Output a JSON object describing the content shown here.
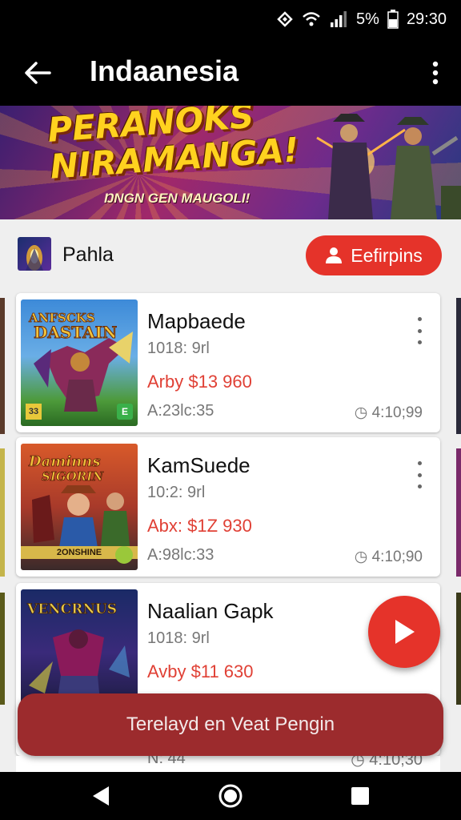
{
  "status_bar": {
    "battery_text": "5%",
    "time": "29:30",
    "icons": [
      "nfc-icon",
      "wifi-icon",
      "signal-icon",
      "battery-icon"
    ]
  },
  "app_bar": {
    "title": "Indaanesia",
    "icons": [
      "back-arrow-icon",
      "more-vert-icon"
    ]
  },
  "banner": {
    "title_line1": "PERANOKS",
    "title_line2": "NIRAMANGA!",
    "subtitle": "ŊNGN GEN MAUGOLI!"
  },
  "section": {
    "name": "Pahla",
    "follow_label": "Eefirpins"
  },
  "cards": [
    {
      "title": "Mapbaede",
      "subtitle": "1018: 9rl",
      "price": "Arby $13 960",
      "meta": "A:23lc:35",
      "time": "4:10;99",
      "thumb_text": "ANFSCKS DASTAIN",
      "thumb_colors": [
        "#3d7fc8",
        "#5d3a8a",
        "#c7a83a"
      ]
    },
    {
      "title": "KamSuede",
      "subtitle": "10:2: 9rl",
      "price": "Abx: $1Z 930",
      "meta": "A:98lc:33",
      "time": "4:10;90",
      "thumb_text": "Daminns SIGORIN",
      "thumb_colors": [
        "#c4512a",
        "#3d3a6a",
        "#e0a03a"
      ]
    },
    {
      "title": "Naalian Gapk",
      "subtitle": "1018: 9rl",
      "price": "Avby $11 630",
      "meta": "",
      "time": "",
      "thumb_text": "VENCRNUS",
      "thumb_colors": [
        "#1a2a66",
        "#6a2a6a",
        "#d0c040"
      ]
    }
  ],
  "thumb_badges": {
    "card1_left": "33",
    "card1_right": "E",
    "card2_strip": "2ONSHINE"
  },
  "peek_row": {
    "left": "N: 44",
    "time": "4:10;30"
  },
  "cta_label": "Terelayd en Veat Pengin",
  "fab_icon": "play-icon",
  "nav_bar": {
    "icons": [
      "nav-back-icon",
      "nav-home-icon",
      "nav-recents-icon"
    ]
  },
  "colors": {
    "accent": "#e5332a",
    "cta": "#9c2b2d",
    "price": "#e04035"
  }
}
